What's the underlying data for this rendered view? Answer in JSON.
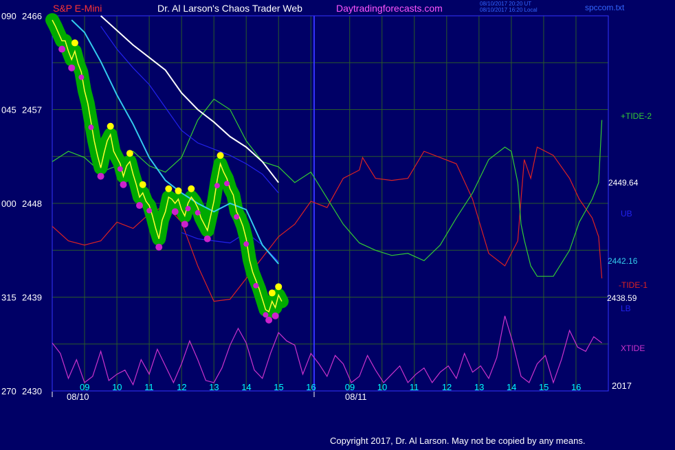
{
  "header": {
    "instrument": "S&P E-Mini",
    "site": "Dr. Al Larson's Chaos Trader Web",
    "url": "Daytradingforecasts.com",
    "stamp_line1": "08/10/2017 20:20 UT",
    "stamp_line2": "08/10/2017 16:20 Local",
    "file": "spccom.txt"
  },
  "footer": {
    "copyright": "Copyright 2017, Dr. Al Larson. May not be copied by any means."
  },
  "colors": {
    "background": "#000066",
    "grid": "#2a5a2a",
    "frame": "#3333ff",
    "price_glow": "#00aa00",
    "price_line": "#ffff33",
    "high_dots": "#ffff00",
    "low_dots": "#cc22cc",
    "tide2": "#33cc33",
    "tide1": "#dd2222",
    "xtide": "#cc33cc",
    "white_ma": "#ffffff",
    "cyan_ma": "#33ccee",
    "blue_band": "#2222ee"
  },
  "chart_data": {
    "type": "line",
    "y_axis": {
      "ticks": [
        2466,
        2457,
        2448,
        2439,
        2430
      ],
      "left_ticks": [
        "090",
        "045",
        "000",
        "315",
        "270"
      ],
      "ylim": [
        2430,
        2466
      ]
    },
    "x_axis": {
      "tick_labels": [
        "09",
        "10",
        "11",
        "12",
        "13",
        "14",
        "15",
        "16",
        "09",
        "10",
        "11",
        "12",
        "13",
        "14",
        "15",
        "16"
      ],
      "day_labels": [
        "08/10",
        "08/11"
      ],
      "year_label": "2017"
    },
    "right_labels": {
      "tide2": "+TIDE-2",
      "white_value": "2449.64",
      "ub": "UB",
      "cyan_value": "2442.16",
      "tide1": "-TIDE-1",
      "close_value": "2438.59",
      "lb": "LB",
      "xtide": "XTIDE"
    },
    "series": {
      "price": {
        "x": [
          0,
          0.1,
          0.2,
          0.3,
          0.4,
          0.5,
          0.6,
          0.7,
          0.8,
          0.9,
          1.0,
          1.1,
          1.2,
          1.3,
          1.4,
          1.5,
          1.6,
          1.7,
          1.8,
          1.9,
          2.0,
          2.1,
          2.2,
          2.3,
          2.4,
          2.5,
          2.6,
          2.7,
          2.8,
          2.9,
          3.0,
          3.1,
          3.2,
          3.3,
          3.4,
          3.5,
          3.6,
          3.7,
          3.8,
          3.9,
          4.0,
          4.1,
          4.2,
          4.3,
          4.4,
          4.5,
          4.6,
          4.7,
          4.8,
          4.9,
          5.0,
          5.1,
          5.2,
          5.3,
          5.4,
          5.5,
          5.6,
          5.7,
          5.8,
          5.9,
          6.0,
          6.1,
          6.2,
          6.3,
          6.4,
          6.5,
          6.6,
          6.7,
          6.8,
          6.9,
          7.0,
          7.1
        ],
        "y": [
          2465.6,
          2465.0,
          2464.3,
          2463.6,
          2463.6,
          2462.6,
          2461.8,
          2462.6,
          2461.4,
          2460.6,
          2458.8,
          2457.6,
          2455.8,
          2454.0,
          2452.6,
          2451.4,
          2452.8,
          2454.0,
          2454.6,
          2453.0,
          2452.4,
          2451.8,
          2450.6,
          2451.6,
          2452.0,
          2450.8,
          2449.8,
          2448.6,
          2449.0,
          2448.2,
          2447.8,
          2446.8,
          2445.6,
          2444.6,
          2446.4,
          2447.2,
          2448.6,
          2448.4,
          2448.0,
          2448.4,
          2447.4,
          2446.8,
          2448.0,
          2448.6,
          2448.2,
          2447.6,
          2446.6,
          2446.0,
          2445.4,
          2446.8,
          2448.2,
          2450.2,
          2451.8,
          2451.0,
          2450.4,
          2449.4,
          2448.8,
          2447.2,
          2446.6,
          2445.8,
          2444.6,
          2442.6,
          2441.4,
          2440.6,
          2439.8,
          2438.8,
          2437.8,
          2437.6,
          2438.6,
          2438.0,
          2439.2,
          2438.6
        ]
      },
      "white": {
        "x": [
          1.5,
          2.0,
          2.5,
          3.0,
          3.5,
          4.0,
          4.5,
          5.0,
          5.5,
          6.0,
          6.5,
          7.0
        ],
        "y": [
          2466.0,
          2464.6,
          2463.2,
          2462.0,
          2460.8,
          2458.6,
          2457.0,
          2455.8,
          2454.4,
          2453.4,
          2452.0,
          2450.0
        ]
      },
      "cyan": {
        "x": [
          0.6,
          1.0,
          1.5,
          2.0,
          2.5,
          3.0,
          3.5,
          4.0,
          4.5,
          5.0,
          5.5,
          6.0,
          6.5,
          7.0
        ],
        "y": [
          2465.6,
          2464.4,
          2461.6,
          2458.4,
          2455.6,
          2452.4,
          2450.2,
          2449.0,
          2448.0,
          2447.2,
          2448.0,
          2447.4,
          2444.0,
          2442.2
        ]
      },
      "ub": {
        "x": [
          1.5,
          2.0,
          2.5,
          3.0,
          3.5,
          4.0,
          4.5,
          5.0,
          5.5,
          6.0,
          6.5,
          7.0
        ],
        "y": [
          2465.0,
          2462.8,
          2461.0,
          2459.4,
          2457.2,
          2455.0,
          2453.8,
          2453.2,
          2452.6,
          2451.8,
          2450.8,
          2449.0
        ]
      },
      "lb": {
        "x": [
          4.0,
          4.5,
          5.0,
          5.5,
          6.0,
          6.5,
          7.0
        ],
        "y": [
          2445.2,
          2444.6,
          2444.4,
          2444.2,
          2445.2,
          2444.0,
          2442.4
        ]
      },
      "tide2": {
        "x": [
          0,
          0.5,
          1.0,
          1.5,
          2.0,
          2.5,
          3.0,
          3.5,
          4.0,
          4.5,
          5.0,
          5.5,
          6.0,
          6.5,
          7.0,
          7.5,
          8.0,
          8.5,
          9.0,
          9.5,
          10.0,
          10.5,
          11.0,
          11.5,
          12.0,
          12.5,
          13.0,
          13.5,
          14.0,
          14.2,
          14.4,
          14.5,
          14.6,
          14.8,
          15.0,
          15.5,
          16.0,
          16.3,
          16.7,
          16.9,
          17.0
        ],
        "y": [
          2452.0,
          2453.0,
          2452.4,
          2451.0,
          2451.6,
          2453.0,
          2451.6,
          2451.0,
          2452.4,
          2456.0,
          2458.0,
          2457.0,
          2454.0,
          2452.0,
          2451.5,
          2450.0,
          2451.0,
          2448.5,
          2446.0,
          2444.2,
          2443.5,
          2443.0,
          2443.2,
          2442.5,
          2444.0,
          2446.6,
          2449.0,
          2452.2,
          2453.4,
          2453.0,
          2450.0,
          2446.0,
          2444.5,
          2442.0,
          2441.0,
          2441.0,
          2443.5,
          2446.2,
          2448.4,
          2450.0,
          2456.0
        ]
      },
      "tide1": {
        "x": [
          0,
          0.5,
          1.0,
          1.5,
          2.0,
          2.5,
          3.0,
          3.5,
          4.0,
          4.5,
          5.0,
          5.5,
          6.0,
          6.5,
          7.0,
          7.5,
          8.0,
          8.5,
          9.0,
          9.5,
          9.6,
          10.0,
          10.5,
          11.0,
          11.5,
          12.0,
          12.5,
          13.0,
          13.5,
          14.0,
          14.4,
          14.5,
          14.6,
          14.8,
          15.0,
          15.5,
          16.0,
          16.3,
          16.7,
          16.9,
          17.0
        ],
        "y": [
          2445.8,
          2444.4,
          2444.0,
          2444.4,
          2446.2,
          2445.6,
          2447.0,
          2447.8,
          2446.2,
          2442.0,
          2438.6,
          2438.8,
          2440.8,
          2442.8,
          2444.8,
          2446.0,
          2448.2,
          2447.6,
          2450.4,
          2451.2,
          2452.4,
          2450.4,
          2450.2,
          2450.4,
          2453.0,
          2452.4,
          2451.8,
          2448.4,
          2443.2,
          2442.0,
          2444.4,
          2448.4,
          2452.2,
          2450.4,
          2453.4,
          2452.6,
          2450.4,
          2448.4,
          2446.6,
          2444.8,
          2440.8
        ]
      },
      "xtide": {
        "x": [
          0,
          0.25,
          0.5,
          0.75,
          1.0,
          1.25,
          1.5,
          1.75,
          2.0,
          2.25,
          2.5,
          2.75,
          3.0,
          3.25,
          3.5,
          3.75,
          4.0,
          4.25,
          4.5,
          4.75,
          5.0,
          5.25,
          5.5,
          5.75,
          6.0,
          6.25,
          6.5,
          6.75,
          7.0,
          7.25,
          7.5,
          7.75,
          8.0,
          8.25,
          8.5,
          8.75,
          9.0,
          9.25,
          9.5,
          9.75,
          10.0,
          10.25,
          10.5,
          10.75,
          11.0,
          11.25,
          11.5,
          11.75,
          12.0,
          12.25,
          12.5,
          12.75,
          13.0,
          13.25,
          13.5,
          13.75,
          14.0,
          14.25,
          14.5,
          14.75,
          15.0,
          15.25,
          15.5,
          15.75,
          16.0,
          16.25,
          16.5,
          16.75,
          17.0
        ],
        "y": [
          2434.6,
          2433.6,
          2431.2,
          2433.0,
          2430.8,
          2431.4,
          2433.8,
          2431.0,
          2431.6,
          2432.0,
          2430.6,
          2433.0,
          2431.6,
          2434.0,
          2432.4,
          2430.8,
          2432.6,
          2434.8,
          2433.0,
          2431.0,
          2430.8,
          2432.2,
          2434.4,
          2436.0,
          2434.6,
          2432.0,
          2431.2,
          2433.6,
          2435.6,
          2434.8,
          2434.4,
          2431.6,
          2433.6,
          2432.6,
          2431.4,
          2433.4,
          2432.6,
          2430.8,
          2431.4,
          2433.4,
          2432.0,
          2430.8,
          2431.6,
          2432.4,
          2430.8,
          2431.6,
          2432.2,
          2430.8,
          2431.8,
          2432.4,
          2431.2,
          2433.6,
          2431.8,
          2432.4,
          2431.2,
          2433.2,
          2437.2,
          2434.6,
          2431.4,
          2430.8,
          2432.6,
          2433.4,
          2430.8,
          2433.0,
          2435.8,
          2434.2,
          2433.8,
          2435.2,
          2434.6
        ]
      }
    },
    "axes": {
      "x_range": [
        0,
        17.2
      ],
      "y_range": [
        2430,
        2466
      ]
    },
    "legend_placement": "right-labels",
    "grid": true
  }
}
